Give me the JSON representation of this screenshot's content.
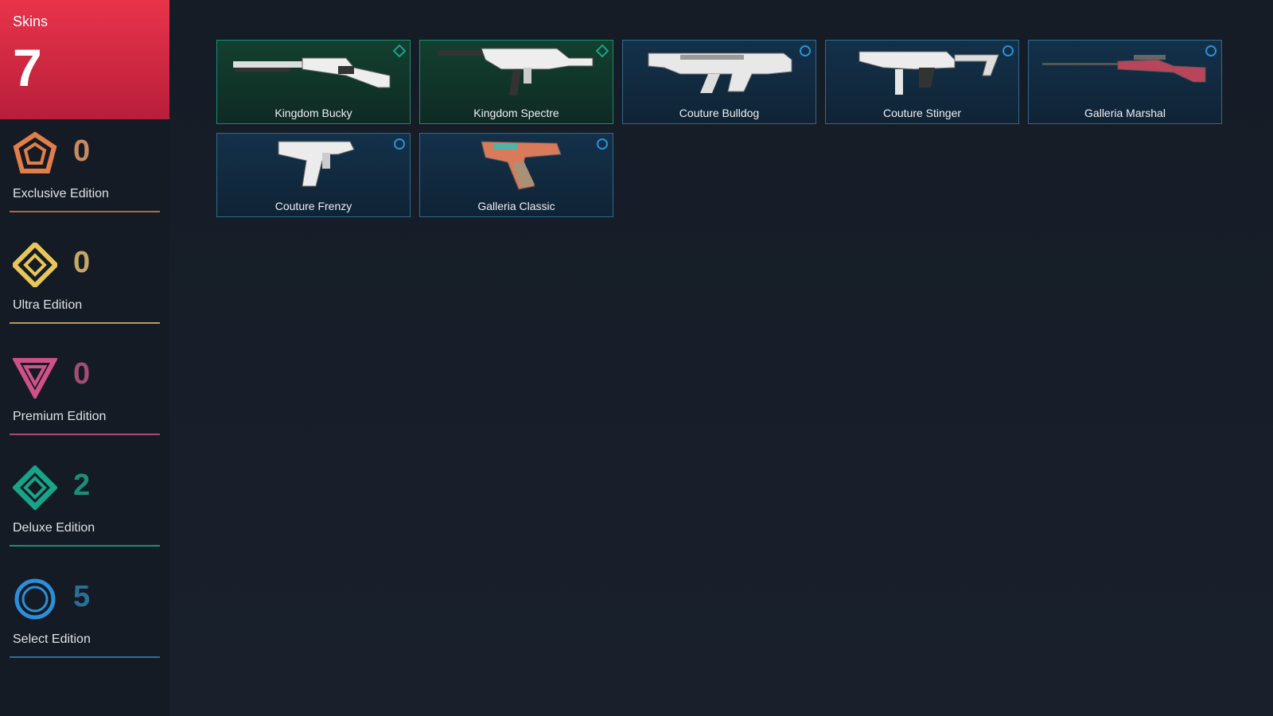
{
  "summary": {
    "label": "Skins",
    "count": "7"
  },
  "tiers": [
    {
      "label": "Exclusive Edition",
      "count": "0",
      "icon": "exclusive-pentagon-icon",
      "color": "#e07f4a",
      "count_color": "#c98a63"
    },
    {
      "label": "Ultra Edition",
      "count": "0",
      "icon": "ultra-diamond-icon",
      "color": "#e8c65a",
      "count_color": "#c4a864"
    },
    {
      "label": "Premium Edition",
      "count": "0",
      "icon": "premium-triangle-icon",
      "color": "#d0508a",
      "count_color": "#a34d72"
    },
    {
      "label": "Deluxe Edition",
      "count": "2",
      "icon": "deluxe-diamond-icon",
      "color": "#18a489",
      "count_color": "#1a8f78"
    },
    {
      "label": "Select Edition",
      "count": "5",
      "icon": "select-circle-icon",
      "color": "#2c8fd8",
      "count_color": "#2b6f9b"
    }
  ],
  "skins": [
    {
      "name": "Kingdom Bucky",
      "tier": "deluxe",
      "weapon": "shotgun"
    },
    {
      "name": "Kingdom Spectre",
      "tier": "deluxe",
      "weapon": "smg"
    },
    {
      "name": "Couture Bulldog",
      "tier": "select",
      "weapon": "rifle"
    },
    {
      "name": "Couture Stinger",
      "tier": "select",
      "weapon": "smg-folding"
    },
    {
      "name": "Galleria Marshal",
      "tier": "select",
      "weapon": "sniper"
    },
    {
      "name": "Couture Frenzy",
      "tier": "select",
      "weapon": "pistol-auto"
    },
    {
      "name": "Galleria Classic",
      "tier": "select",
      "weapon": "pistol"
    }
  ]
}
